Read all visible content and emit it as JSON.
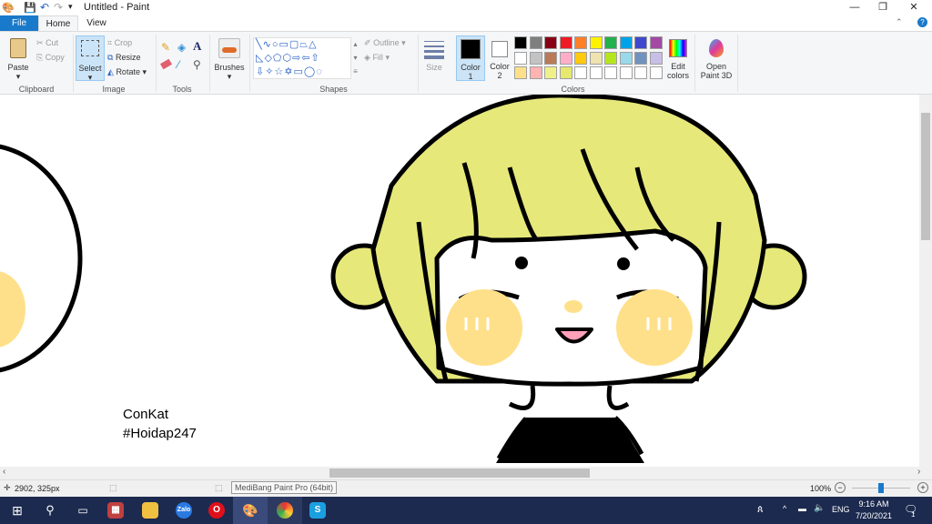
{
  "window": {
    "title": "Untitled - Paint"
  },
  "tabs": [
    {
      "label": "File"
    },
    {
      "label": "Home"
    },
    {
      "label": "View"
    }
  ],
  "ribbon": {
    "clipboard": {
      "paste": "Paste",
      "cut": "Cut",
      "copy": "Copy",
      "group": "Clipboard"
    },
    "image": {
      "select": "Select",
      "crop": "Crop",
      "resize": "Resize",
      "rotate": "Rotate",
      "group": "Image"
    },
    "tools": {
      "group": "Tools"
    },
    "brushes": {
      "label": "Brushes"
    },
    "shapes": {
      "outline": "Outline",
      "fill": "Fill",
      "group": "Shapes"
    },
    "size": {
      "label": "Size"
    },
    "colors": {
      "color1": "Color",
      "color1_num": "1",
      "color2": "Color",
      "color2_num": "2",
      "edit": "Edit colors",
      "group": "Colors",
      "color1_value": "#000000",
      "color2_value": "#ffffff",
      "palette": [
        "#000000",
        "#7f7f7f",
        "#880015",
        "#ed1c24",
        "#ff7f27",
        "#fff200",
        "#22b14c",
        "#00a2e8",
        "#3f48cc",
        "#a349a4",
        "#ffffff",
        "#c3c3c3",
        "#b97a57",
        "#ffaec9",
        "#ffc90e",
        "#efe4b0",
        "#b5e61d",
        "#99d9ea",
        "#7092be",
        "#c8bfe7",
        "#ffe08a",
        "#ffb3b3",
        "#f0f08a",
        "#e6e870",
        "#ffffff",
        "#ffffff",
        "#ffffff",
        "#ffffff",
        "#ffffff",
        "#ffffff"
      ]
    },
    "paint3d": "Open Paint 3D"
  },
  "canvas": {
    "text_line1": "ConKat",
    "text_line2": "#Hoidap247",
    "hair_color": "#e6e87a",
    "cheek_color": "#ffe08a"
  },
  "status": {
    "cursor": "2902, 325px",
    "zoom": "100%",
    "zoom_level": 0.5,
    "tooltip": "MediBang Paint Pro (64bit)"
  },
  "taskbar": {
    "apps": [
      "Start",
      "Search",
      "Task View",
      "Store",
      "File Explorer",
      "Zalo",
      "Opera",
      "Paint",
      "Chrome",
      "Skype"
    ],
    "lang": "ENG",
    "time": "9:16 AM",
    "date": "7/20/2021",
    "notif_count": "1"
  }
}
